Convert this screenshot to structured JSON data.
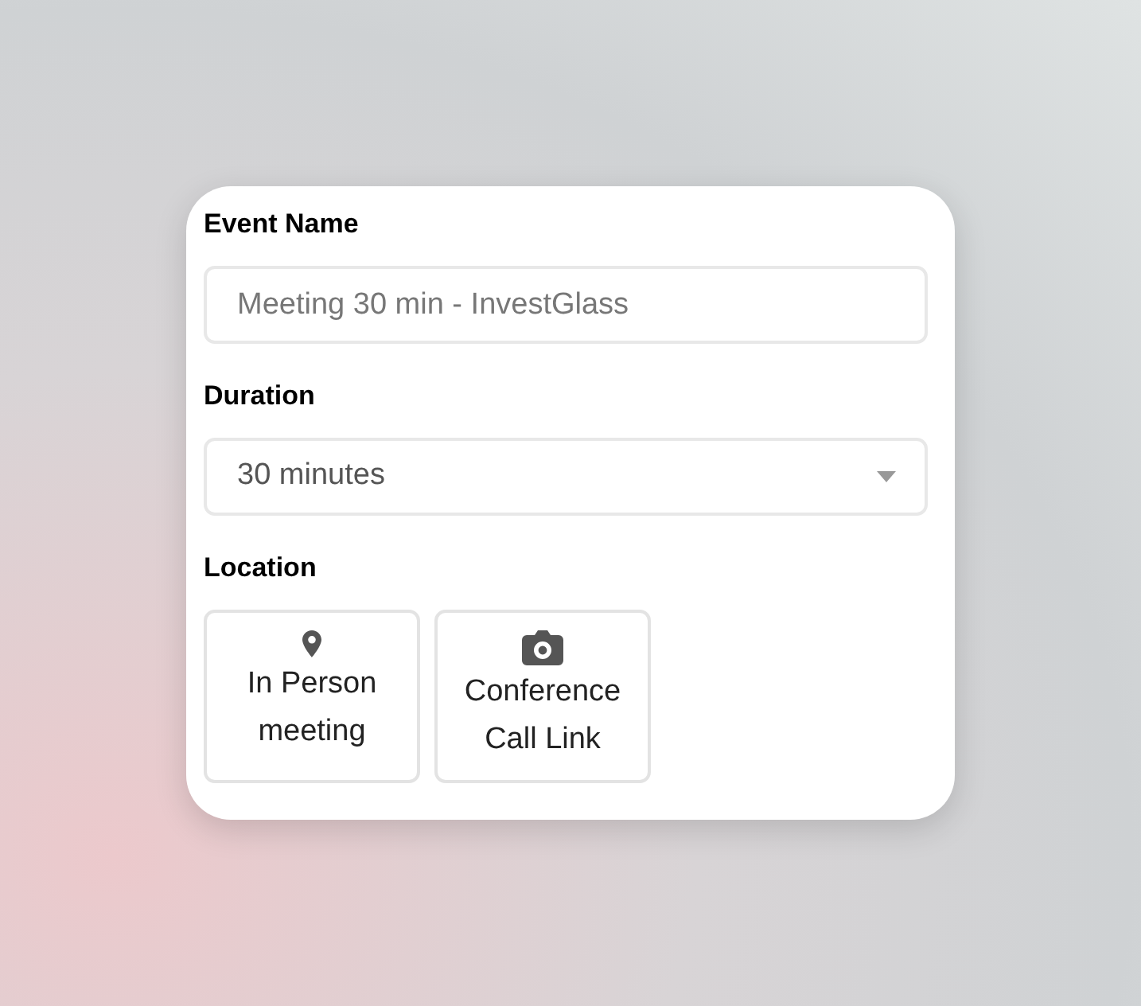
{
  "event_name": {
    "label": "Event Name",
    "placeholder": "Meeting 30 min - InvestGlass"
  },
  "duration": {
    "label": "Duration",
    "value": "30 minutes"
  },
  "location": {
    "label": "Location",
    "options": [
      {
        "kind": "pin",
        "label": "In Person meeting"
      },
      {
        "kind": "camera",
        "label": "Conference Call Link"
      }
    ]
  }
}
